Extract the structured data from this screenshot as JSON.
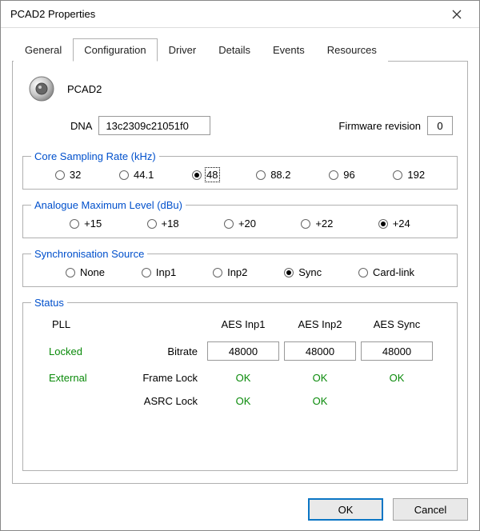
{
  "window": {
    "title": "PCAD2 Properties"
  },
  "tabs": [
    "General",
    "Configuration",
    "Driver",
    "Details",
    "Events",
    "Resources"
  ],
  "active_tab": 1,
  "device": {
    "name": "PCAD2",
    "dna_label": "DNA",
    "dna_value": "13c2309c21051f0",
    "fw_label": "Firmware revision",
    "fw_value": "0"
  },
  "groups": {
    "rate": {
      "legend": "Core Sampling Rate (kHz)",
      "options": [
        "32",
        "44.1",
        "48",
        "88.2",
        "96",
        "192"
      ],
      "selected": 2
    },
    "level": {
      "legend": "Analogue Maximum Level (dBu)",
      "options": [
        "+15",
        "+18",
        "+20",
        "+22",
        "+24"
      ],
      "selected": 4
    },
    "sync": {
      "legend": "Synchronisation Source",
      "options": [
        "None",
        "Inp1",
        "Inp2",
        "Sync",
        "Card-link"
      ],
      "selected": 3
    },
    "status": {
      "legend": "Status",
      "headers": [
        "PLL",
        "AES Inp1",
        "AES Inp2",
        "AES Sync"
      ],
      "row_labels": [
        "Bitrate",
        "Frame Lock",
        "ASRC Lock"
      ],
      "pll": [
        "Locked",
        "External"
      ],
      "bitrate": [
        "48000",
        "48000",
        "48000"
      ],
      "framelock": [
        "OK",
        "OK",
        "OK"
      ],
      "asrclock": [
        "OK",
        "OK",
        ""
      ]
    }
  },
  "buttons": {
    "ok": "OK",
    "cancel": "Cancel"
  }
}
